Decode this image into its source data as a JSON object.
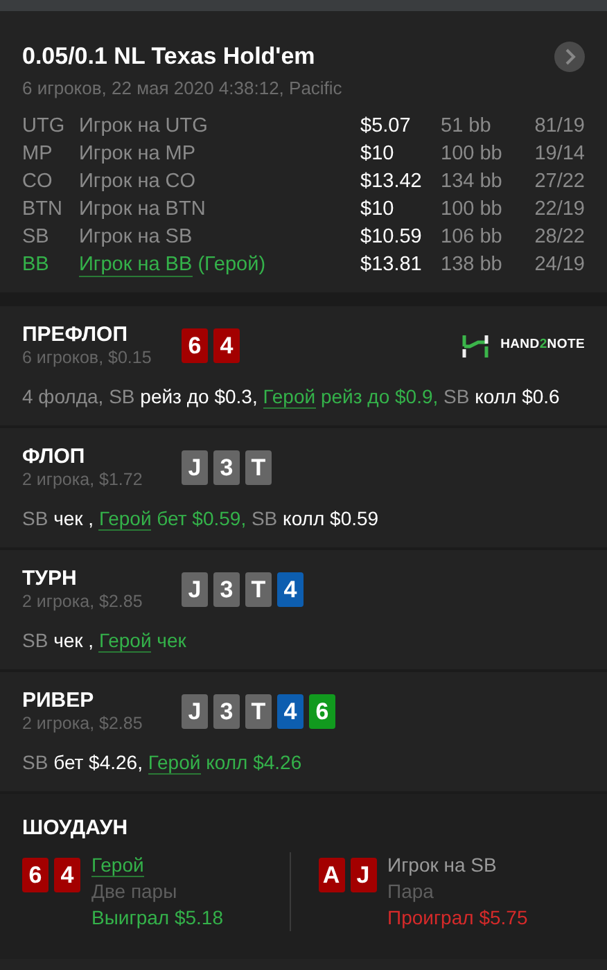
{
  "header": {
    "title": "0.05/0.1 NL Texas Hold'em",
    "subtitle": "6 игроков, 22 мая 2020 4:38:12, Pacific"
  },
  "players": [
    {
      "position": "UTG",
      "name": "Игрок на UTG",
      "hero": false,
      "stack": "$5.07",
      "bb": "51 bb",
      "stats": "81/19"
    },
    {
      "position": "MP",
      "name": "Игрок на MP",
      "hero": false,
      "stack": "$10",
      "bb": "100 bb",
      "stats": "19/14"
    },
    {
      "position": "CO",
      "name": "Игрок на CO",
      "hero": false,
      "stack": "$13.42",
      "bb": "134 bb",
      "stats": "27/22"
    },
    {
      "position": "BTN",
      "name": "Игрок на BTN",
      "hero": false,
      "stack": "$10",
      "bb": "100 bb",
      "stats": "22/19"
    },
    {
      "position": "SB",
      "name": "Игрок на SB",
      "hero": false,
      "stack": "$10.59",
      "bb": "106 bb",
      "stats": "28/22"
    },
    {
      "position": "BB",
      "name": "Игрок на BB",
      "hero": true,
      "hero_tag": "(Герой)",
      "stack": "$13.81",
      "bb": "138 bb",
      "stats": "24/19"
    }
  ],
  "logo": {
    "parts": [
      "HAND",
      "2",
      "NOTE"
    ]
  },
  "streets": [
    {
      "name": "ПРЕФЛОП",
      "info": "6 игроков, $0.15",
      "cards": [
        {
          "rank": "6",
          "color": "#a30000"
        },
        {
          "rank": "4",
          "color": "#a30000"
        }
      ],
      "actions": [
        {
          "text": "4 фолда, ",
          "kind": "muted"
        },
        {
          "text": "SB",
          "kind": "muted"
        },
        {
          "text": " рейз до $0.3, ",
          "kind": "bright"
        },
        {
          "text": "Герой",
          "kind": "hero_link"
        },
        {
          "text": " рейз до $0.9, ",
          "kind": "hero"
        },
        {
          "text": "SB",
          "kind": "muted"
        },
        {
          "text": " колл $0.6",
          "kind": "bright"
        }
      ]
    },
    {
      "name": "ФЛОП",
      "info": "2 игрока, $1.72",
      "cards": [
        {
          "rank": "J",
          "color": "#666666"
        },
        {
          "rank": "3",
          "color": "#666666"
        },
        {
          "rank": "T",
          "color": "#666666"
        }
      ],
      "actions": [
        {
          "text": "SB",
          "kind": "muted"
        },
        {
          "text": " чек , ",
          "kind": "bright"
        },
        {
          "text": "Герой",
          "kind": "hero_link"
        },
        {
          "text": " бет $0.59, ",
          "kind": "hero"
        },
        {
          "text": "SB",
          "kind": "muted"
        },
        {
          "text": " колл $0.59",
          "kind": "bright"
        }
      ]
    },
    {
      "name": "ТУРН",
      "info": "2 игрока, $2.85",
      "cards": [
        {
          "rank": "J",
          "color": "#666666"
        },
        {
          "rank": "3",
          "color": "#666666"
        },
        {
          "rank": "T",
          "color": "#666666"
        },
        {
          "rank": "4",
          "color": "#0d5eb0"
        }
      ],
      "actions": [
        {
          "text": "SB",
          "kind": "muted"
        },
        {
          "text": " чек , ",
          "kind": "bright"
        },
        {
          "text": "Герой",
          "kind": "hero_link"
        },
        {
          "text": " чек",
          "kind": "hero"
        }
      ]
    },
    {
      "name": "РИВЕР",
      "info": "2 игрока, $2.85",
      "cards": [
        {
          "rank": "J",
          "color": "#666666"
        },
        {
          "rank": "3",
          "color": "#666666"
        },
        {
          "rank": "T",
          "color": "#666666"
        },
        {
          "rank": "4",
          "color": "#0d5eb0"
        },
        {
          "rank": "6",
          "color": "#119a1e"
        }
      ],
      "actions": [
        {
          "text": "SB",
          "kind": "muted"
        },
        {
          "text": " бет $4.26, ",
          "kind": "bright"
        },
        {
          "text": "Герой",
          "kind": "hero_link"
        },
        {
          "text": " колл $4.26",
          "kind": "hero"
        }
      ]
    }
  ],
  "showdown": {
    "title": "ШОУДАУН",
    "hands": [
      {
        "cards": [
          {
            "rank": "6",
            "color": "#a30000"
          },
          {
            "rank": "4",
            "color": "#a30000"
          }
        ],
        "player": "Герой",
        "hero": true,
        "hand_name": "Две пары",
        "result": "Выиграл $5.18",
        "won": true
      },
      {
        "cards": [
          {
            "rank": "A",
            "color": "#a30000"
          },
          {
            "rank": "J",
            "color": "#a30000"
          }
        ],
        "player": "Игрок на SB",
        "hero": false,
        "hand_name": "Пара",
        "result": "Проиграл $5.75",
        "won": false
      }
    ]
  }
}
